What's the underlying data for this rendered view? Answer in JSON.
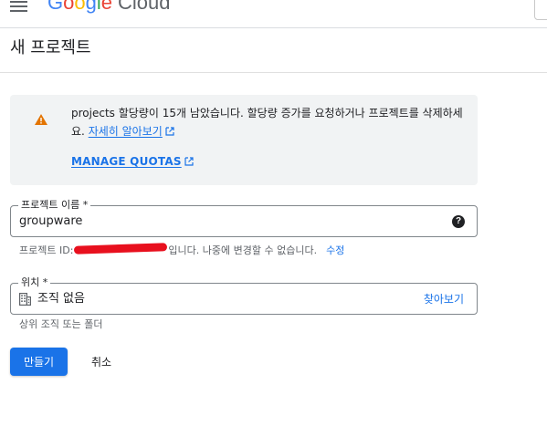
{
  "header": {
    "menu_icon": "hamburger-menu-icon",
    "logo_google": "Google",
    "logo_cloud": "Cloud",
    "logo_colors": [
      "#4285f4",
      "#ea4335",
      "#fbbc05",
      "#4285f4",
      "#34a853",
      "#ea4335"
    ]
  },
  "page": {
    "title": "새 프로젝트"
  },
  "notice": {
    "icon": "warning-icon",
    "text": "projects 할당량이 15개 남았습니다. 할당량 증가를 요청하거나 프로젝트를 삭제하세요.",
    "learn_more": "자세히 알아보기",
    "manage_quotas": "MANAGE QUOTAS",
    "warning_color": "#e37400"
  },
  "project_name": {
    "label": "프로젝트 이름 *",
    "value": "groupware",
    "help_icon": "help-circle-icon"
  },
  "project_id": {
    "prefix": "프로젝트 ID:",
    "visible_fragment": "",
    "suffix": "입니다. 나중에 변경할 수 없습니다.",
    "edit_label": "수정"
  },
  "location": {
    "label": "위치 *",
    "icon": "organization-building-icon",
    "value": "조직 없음",
    "browse_label": "찾아보기",
    "hint": "상위 조직 또는 폴더"
  },
  "actions": {
    "create_label": "만들기",
    "cancel_label": "취소",
    "primary_color": "#1a73e8"
  }
}
